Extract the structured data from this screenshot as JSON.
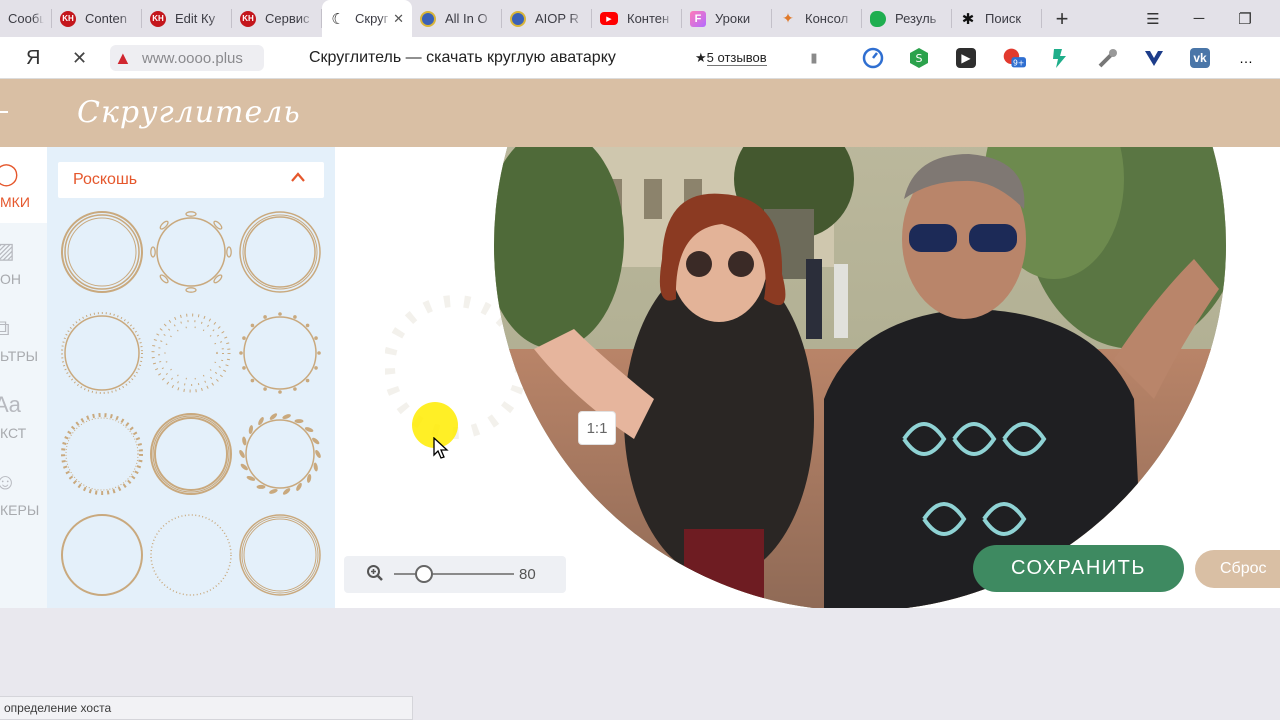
{
  "browser": {
    "tabs": [
      {
        "label": "Сообщ",
        "icon": "none"
      },
      {
        "label": "Conten",
        "icon": "kh"
      },
      {
        "label": "Edit Ку",
        "icon": "kh"
      },
      {
        "label": "Сервис",
        "icon": "kh"
      },
      {
        "label": "Скруг",
        "icon": "moon",
        "active": true
      },
      {
        "label": "All In O",
        "icon": "globe"
      },
      {
        "label": "AIOP R",
        "icon": "globe"
      },
      {
        "label": "Контен",
        "icon": "yt"
      },
      {
        "label": "Уроки",
        "icon": "f"
      },
      {
        "label": "Консол",
        "icon": "key"
      },
      {
        "label": "Резуль",
        "icon": "ever"
      },
      {
        "label": "Поиск",
        "icon": "spider"
      }
    ],
    "kh_text": "KH",
    "moon_glyph": "☾",
    "close_glyph": "✕",
    "add_tab_glyph": "+",
    "window": {
      "menu": "☰",
      "minimize": "─",
      "restore": "❐"
    },
    "yandex_glyph": "Я",
    "stop_glyph": "✕",
    "warning_glyph": "▲",
    "url": "www.oooo.plus",
    "page_title": "Скруглитель — скачать круглую аватарку",
    "reviews_star": "★",
    "reviews": "5 отзывов",
    "bookmark_glyph": "▮",
    "more_glyph": "…",
    "ext_badge": "9+"
  },
  "site": {
    "logo": "Скруглитель",
    "nav": [
      {
        "label": "МКИ",
        "icon": "frames-icon",
        "glyph": "◯",
        "active": true
      },
      {
        "label": "ОН",
        "icon": "background-icon",
        "glyph": "▨"
      },
      {
        "label": "ЬТРЫ",
        "icon": "filters-icon",
        "glyph": "⧉"
      },
      {
        "label": "КСТ",
        "icon": "text-icon",
        "glyph": "Aa"
      },
      {
        "label": "КЕРЫ",
        "icon": "stickers-icon",
        "glyph": "☺"
      }
    ],
    "frames_panel": {
      "category": "Роскошь",
      "chevron": "⌃",
      "frame_styles": [
        "double-ring",
        "floral",
        "thin-double",
        "beaded",
        "dots",
        "laurel",
        "dotted-beads",
        "sketch",
        "leaf-wreath",
        "single",
        "fine-dots",
        "triple-thin"
      ]
    },
    "zoom": {
      "value": "80",
      "percent": 80,
      "icon": "zoom-in-icon",
      "glyph": "⊕"
    },
    "one_to_one": "1:1",
    "save": "СОХРАНИТЬ",
    "reset": "Сброс"
  },
  "status": "определение хоста",
  "colors": {
    "accent": "#e5572c",
    "header": "#d9bfa4",
    "save": "#3e8a61",
    "panel": "#e4f0fa",
    "frame": "#c9a97e"
  }
}
